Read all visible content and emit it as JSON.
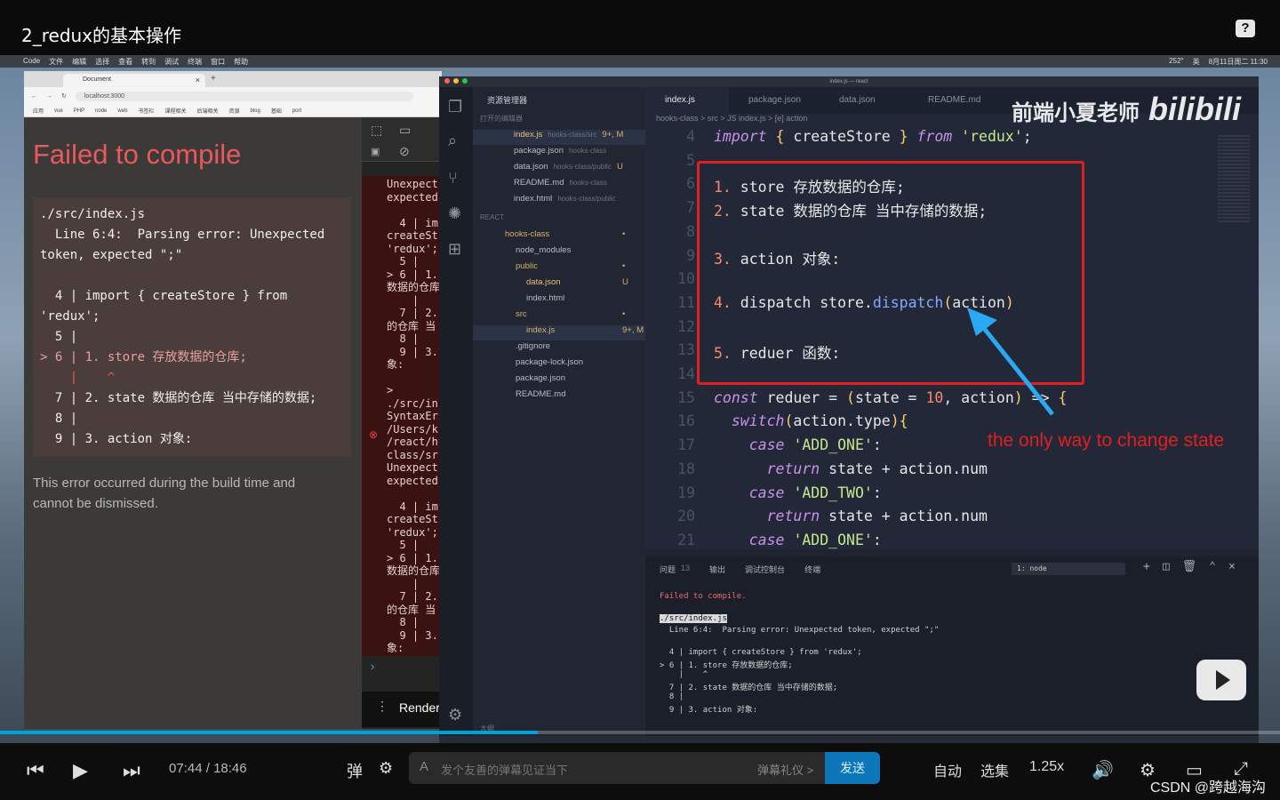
{
  "video_title": "2_redux的基本操作",
  "help_icon": "?",
  "menubar": {
    "left": [
      "",
      "Code",
      "文件",
      "编辑",
      "选择",
      "查看",
      "转到",
      "调试",
      "终端",
      "窗口",
      "帮助"
    ],
    "right": [
      "252°",
      "英",
      "8月11日周二 11:30"
    ]
  },
  "browser": {
    "tab_title": "Document",
    "url": "localhost:3000",
    "bookmarks": [
      "应用",
      "vue",
      "PHP",
      "node",
      "web",
      "书签栏",
      "课程相关",
      "后端相关",
      "资源",
      "blog",
      "基础",
      "port"
    ],
    "error_title": "Failed to compile",
    "error_lines": [
      "./src/index.js",
      "  Line 6:4:  Parsing error: Unexpected",
      "token, expected \";\"",
      "",
      "  4 | import { createStore } from",
      "'redux';",
      "  5 |",
      "> 6 | 1. store 存放数据的仓库;",
      "    |    ^",
      "  7 | 2. state 数据的仓库 当中存储的数据;",
      "  8 |",
      "  9 | 3. action 对象:"
    ],
    "error_note": "This error occurred during the build time and cannot be dismissed."
  },
  "devtools": {
    "console_text": "Unexpect\nexpected\n\n  4 | im\ncreateSt\n'redux';\n  5 |\n> 6 | 1.\n数据的仓库\n    |\n  7 | 2.\n的仓库 当\n  8 |\n  9 | 3.\n象:\n\n>\n./src/in\nSyntaxEr\n/Users/k\n/react/h\nclass/sr\nUnexpect\nexpected\n\n  4 | im\ncreateSt\n'redux';\n  5 |\n> 6 | 1.\n数据的仓库\n    |\n  7 | 2.\n的仓库 当\n  8 |\n  9 | 3.\n象:",
    "render_label": "Render"
  },
  "vscode": {
    "window_title": "index.js — react",
    "explorer_title": "资源管理器",
    "open_editors_label": "打开的编辑器",
    "open_editors": [
      {
        "name": "index.js",
        "path": "hooks-class/src",
        "status": "9+, M"
      },
      {
        "name": "package.json",
        "path": "hooks-class",
        "status": ""
      },
      {
        "name": "data.json",
        "path": "hooks-class/public",
        "status": "U"
      },
      {
        "name": "README.md",
        "path": "hooks-class",
        "status": ""
      },
      {
        "name": "index.html",
        "path": "hooks-class/public",
        "status": ""
      }
    ],
    "workspace_label": "REACT",
    "tree": [
      {
        "name": "hooks-class",
        "status": "•"
      },
      {
        "name": "node_modules",
        "status": ""
      },
      {
        "name": "public",
        "status": "•"
      },
      {
        "name": "data.json",
        "status": "U"
      },
      {
        "name": "index.html",
        "status": ""
      },
      {
        "name": "src",
        "status": "•"
      },
      {
        "name": "index.js",
        "status": "9+, M"
      },
      {
        "name": ".gitignore",
        "status": ""
      },
      {
        "name": "package-lock.json",
        "status": ""
      },
      {
        "name": "package.json",
        "status": ""
      },
      {
        "name": "README.md",
        "status": ""
      }
    ],
    "outline_label": "大纲",
    "tabs": [
      "index.js",
      "package.json",
      "data.json",
      "README.md"
    ],
    "breadcrumb": "hooks-class > src > JS index.js > [e] action",
    "watermark_text": "前端小夏老师",
    "watermark_logo": "bilibili",
    "annotation": "the only way to change state",
    "code": [
      {
        "n": "4",
        "t": "import { createStore } from 'redux';"
      },
      {
        "n": "5",
        "t": ""
      },
      {
        "n": "6",
        "t": "1. store 存放数据的仓库;"
      },
      {
        "n": "7",
        "t": "2. state 数据的仓库 当中存储的数据;"
      },
      {
        "n": "8",
        "t": ""
      },
      {
        "n": "9",
        "t": "3. action 对象:"
      },
      {
        "n": "10",
        "t": ""
      },
      {
        "n": "11",
        "t": "4. dispatch store.dispatch(action)"
      },
      {
        "n": "12",
        "t": ""
      },
      {
        "n": "13",
        "t": "5. reduer 函数:"
      },
      {
        "n": "14",
        "t": ""
      },
      {
        "n": "15",
        "t": "const reduer = (state = 10, action) => {"
      },
      {
        "n": "16",
        "t": "  switch(action.type){"
      },
      {
        "n": "17",
        "t": "    case 'ADD_ONE':"
      },
      {
        "n": "18",
        "t": "      return state + action.num"
      },
      {
        "n": "19",
        "t": "    case 'ADD_TWO':"
      },
      {
        "n": "20",
        "t": "      return state + action.num"
      },
      {
        "n": "21",
        "t": "    case 'ADD_ONE':"
      }
    ],
    "panel": {
      "tabs": [
        "问题",
        "13",
        "输出",
        "调试控制台",
        "终端"
      ],
      "terminal_select": "1: node",
      "lines": [
        "Failed to compile.",
        "",
        "./src/index.js",
        "  Line 6:4:  Parsing error: Unexpected token, expected \";\"",
        "",
        "  4 | import { createStore } from 'redux';",
        "> 6 | 1. store 存放数据的仓库;",
        "    |    ^",
        "  7 | 2. state 数据的仓库 当中存储的数据;",
        "  8 |",
        "  9 | 3. action 对象:"
      ]
    }
  },
  "player": {
    "time_current": "07:44",
    "time_sep": "/",
    "time_total": "18:46",
    "danmaku_placeholder": "发个友善的弹幕见证当下",
    "danmaku_etiquette": "弹幕礼仪 >",
    "send_label": "发送",
    "auto_label": "自动",
    "episodes_label": "选集",
    "speed_label": "1.25x",
    "progress": 0.42,
    "credit": "CSDN @跨越海沟"
  }
}
